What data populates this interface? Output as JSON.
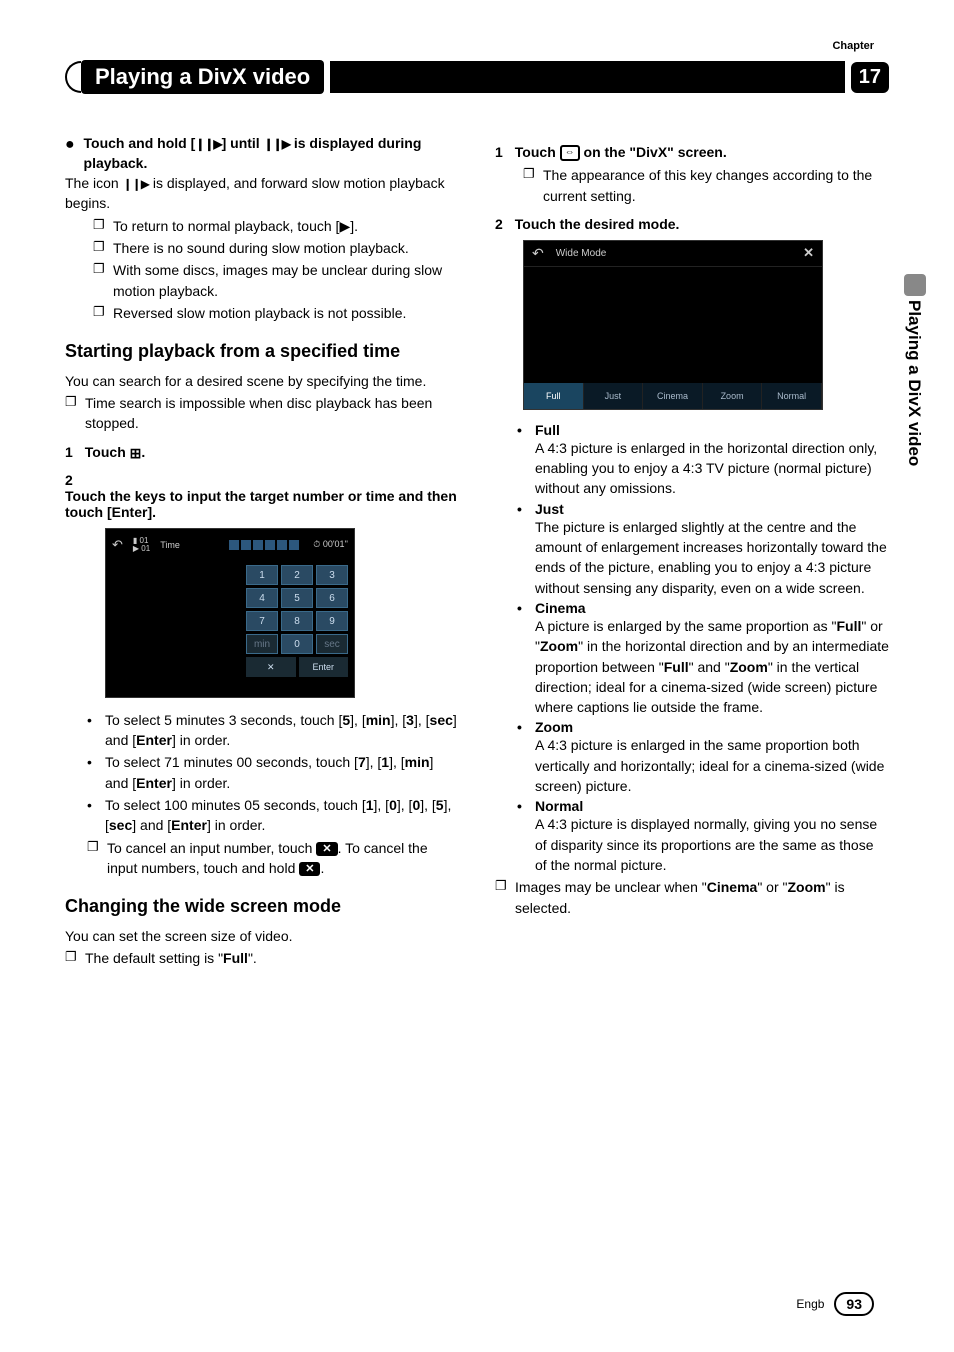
{
  "chapter_label": "Chapter",
  "chapter_num": "17",
  "page_title": "Playing a DivX video",
  "vertical_tab": "Playing a DivX video",
  "footer_lang": "Engb",
  "footer_page": "93",
  "left": {
    "lead_bullet_pre": "Touch and hold [",
    "lead_bullet_mid": "] until ",
    "lead_bullet_post": " is displayed during playback.",
    "icon_text_pre": "The icon ",
    "icon_text_post": " is displayed, and forward slow motion playback begins.",
    "notes": [
      "To return to normal playback, touch [▶].",
      "There is no sound during slow motion playback.",
      "With some discs, images may be unclear during slow motion playback.",
      "Reversed slow motion playback is not possible."
    ],
    "h_start": "Starting playback from a specified time",
    "start_desc": "You can search for a desired scene by specifying the time.",
    "start_note": "Time search is impossible when disc playback has been stopped.",
    "step1_pre": "Touch ",
    "step1_post": ".",
    "step2": "Touch the keys to input the target number or time and then touch [Enter].",
    "shot_time": {
      "label": "Time",
      "timecode": "00'01''",
      "keys": [
        "1",
        "2",
        "3",
        "4",
        "5",
        "6",
        "7",
        "8",
        "9",
        "min",
        "0",
        "sec"
      ],
      "cancel": "✕",
      "enter": "Enter"
    },
    "examples_label_5": "To select 5 minutes 3 seconds, touch [",
    "examples_5_seq": [
      "5",
      "], [",
      "min",
      "], [",
      "3",
      "], [",
      "sec",
      "] and [",
      "Enter",
      "] in order."
    ],
    "examples_label_71": "To select 71 minutes 00 seconds, touch [",
    "examples_71_seq": [
      "7",
      "], [",
      "1",
      "], [",
      "min",
      "] and [",
      "Enter",
      "] in order."
    ],
    "examples_label_100": "To select 100 minutes 05 seconds, touch [",
    "examples_100_seq": [
      "1",
      "], [",
      "0",
      "], [",
      "0",
      "], [",
      "5",
      "], [",
      "sec",
      "] and [",
      "Enter",
      "] in order."
    ],
    "cancel_note_pre": "To cancel an input number, touch ",
    "cancel_note_mid": ". To cancel the input numbers, touch and hold ",
    "cancel_note_post": ".",
    "h_wide": "Changing the wide screen mode",
    "wide_desc": "You can set the screen size of video.",
    "wide_note_pre": "The default setting is \"",
    "wide_note_bold": "Full",
    "wide_note_post": "\"."
  },
  "right": {
    "step1_pre": "Touch ",
    "step1_post": " on the \"DivX\" screen.",
    "step1_note": "The appearance of this key changes according to the current setting.",
    "step2": "Touch the desired mode.",
    "shot_wide": {
      "title": "Wide Mode",
      "tabs": [
        "Full",
        "Just",
        "Cinema",
        "Zoom",
        "Normal"
      ]
    },
    "modes": [
      {
        "name": "Full",
        "desc": "A 4:3 picture is enlarged in the horizontal direction only, enabling you to enjoy a 4:3 TV picture (normal picture) without any omissions."
      },
      {
        "name": "Just",
        "desc": "The picture is enlarged slightly at the centre and the amount of enlargement increases horizontally toward the ends of the picture, enabling you to enjoy a 4:3 picture without sensing any disparity, even on a wide screen."
      },
      {
        "name": "Cinema",
        "desc_parts": [
          "A picture is enlarged by the same proportion as \"",
          "Full",
          "\" or \"",
          "Zoom",
          "\" in the horizontal direction and by an intermediate proportion between \"",
          "Full",
          "\" and \"",
          "Zoom",
          "\" in the vertical direction; ideal for a cinema-sized (wide screen) picture where captions lie outside the frame."
        ]
      },
      {
        "name": "Zoom",
        "desc": "A 4:3 picture is enlarged in the same proportion both vertically and horizontally; ideal for a cinema-sized (wide screen) picture."
      },
      {
        "name": "Normal",
        "desc": "A 4:3 picture is displayed normally, giving you no sense of disparity since its proportions are the same as those of the normal picture."
      }
    ],
    "final_note_pre": "Images may be unclear when \"",
    "final_note_b1": "Cinema",
    "final_note_mid": "\" or \"",
    "final_note_b2": "Zoom",
    "final_note_post": "\" is selected."
  }
}
